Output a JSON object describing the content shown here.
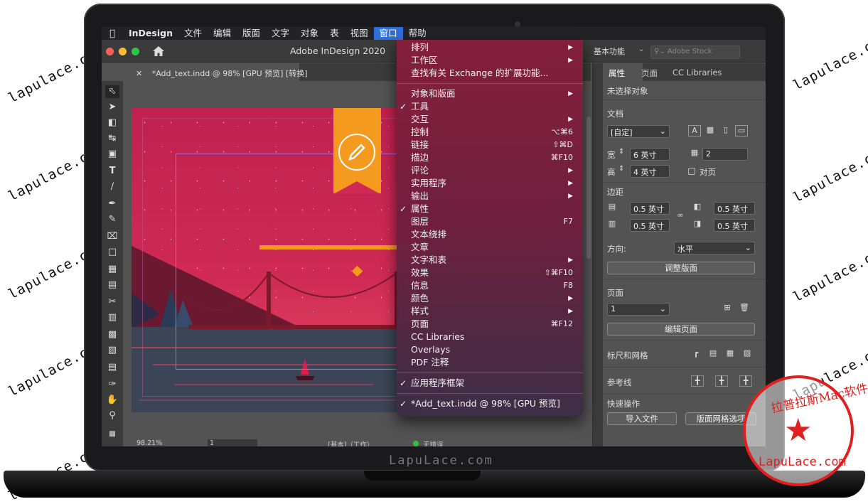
{
  "watermarks": [
    "lapulace.com",
    "lapulace.com",
    "lapulace.com",
    "lapulace.com",
    "lapulace.com",
    "lapulace.com",
    "lapulace.com",
    "lapulace.com",
    "lapulace.com",
    "lapulace.com"
  ],
  "laptop_brand": "LapuLace.com",
  "menubar": {
    "app": "InDesign",
    "items": [
      "文件",
      "编辑",
      "版面",
      "文字",
      "对象",
      "表",
      "视图",
      "窗口",
      "帮助"
    ]
  },
  "titlebar": {
    "title": "Adobe InDesign 2020",
    "workspace": "基本功能",
    "stock_placeholder": "Adobe Stock"
  },
  "doc_tab": {
    "name": "*Add_text.indd @ 98% [GPU 预览] [转换]"
  },
  "window_menu": {
    "items": [
      {
        "label": "排列",
        "shortcut": "",
        "submenu": true,
        "checked": false
      },
      {
        "label": "工作区",
        "shortcut": "",
        "submenu": true,
        "checked": false
      },
      {
        "label": "查找有关 Exchange 的扩展功能...",
        "shortcut": "",
        "submenu": false,
        "checked": false
      },
      {
        "sep": true
      },
      {
        "label": "对象和版面",
        "shortcut": "",
        "submenu": true,
        "checked": false
      },
      {
        "label": "工具",
        "shortcut": "",
        "submenu": false,
        "checked": true
      },
      {
        "label": "交互",
        "shortcut": "",
        "submenu": true,
        "checked": false
      },
      {
        "label": "控制",
        "shortcut": "⌥⌘6",
        "submenu": false,
        "checked": false
      },
      {
        "label": "链接",
        "shortcut": "⇧⌘D",
        "submenu": false,
        "checked": false
      },
      {
        "label": "描边",
        "shortcut": "⌘F10",
        "submenu": false,
        "checked": false
      },
      {
        "label": "评论",
        "shortcut": "",
        "submenu": true,
        "checked": false
      },
      {
        "label": "实用程序",
        "shortcut": "",
        "submenu": true,
        "checked": false
      },
      {
        "label": "输出",
        "shortcut": "",
        "submenu": true,
        "checked": false
      },
      {
        "label": "属性",
        "shortcut": "",
        "submenu": false,
        "checked": true
      },
      {
        "label": "图层",
        "shortcut": "F7",
        "submenu": false,
        "checked": false
      },
      {
        "label": "文本绕排",
        "shortcut": "",
        "submenu": false,
        "checked": false
      },
      {
        "label": "文章",
        "shortcut": "",
        "submenu": false,
        "checked": false
      },
      {
        "label": "文字和表",
        "shortcut": "",
        "submenu": true,
        "checked": false
      },
      {
        "label": "效果",
        "shortcut": "⇧⌘F10",
        "submenu": false,
        "checked": false
      },
      {
        "label": "信息",
        "shortcut": "F8",
        "submenu": false,
        "checked": false
      },
      {
        "label": "颜色",
        "shortcut": "",
        "submenu": true,
        "checked": false
      },
      {
        "label": "样式",
        "shortcut": "",
        "submenu": true,
        "checked": false
      },
      {
        "label": "页面",
        "shortcut": "⌘F12",
        "submenu": false,
        "checked": false
      },
      {
        "label": "CC Libraries",
        "shortcut": "",
        "submenu": false,
        "checked": false
      },
      {
        "label": "Overlays",
        "shortcut": "",
        "submenu": false,
        "checked": false
      },
      {
        "label": "PDF 注释",
        "shortcut": "",
        "submenu": false,
        "checked": false
      },
      {
        "sep": true
      },
      {
        "label": "应用程序框架",
        "shortcut": "",
        "submenu": false,
        "checked": true
      },
      {
        "sep": true
      },
      {
        "label": "*Add_text.indd @ 98% [GPU 预览]",
        "shortcut": "",
        "submenu": false,
        "checked": true
      }
    ]
  },
  "panel": {
    "tabs": [
      "属性",
      "页面",
      "CC Libraries"
    ],
    "no_selection": "未选择对象",
    "document_heading": "文档",
    "preset": "[自定]",
    "width_label": "宽",
    "width_value": "6 英寸",
    "height_label": "高",
    "height_value": "4 英寸",
    "pages_value": "2",
    "facing_pages": "对页",
    "margins_heading": "边距",
    "margin_top": "0.5 英寸",
    "margin_bottom": "0.5 英寸",
    "margin_left": "0.5 英寸",
    "margin_right": "0.5 英寸",
    "orientation_label": "方向:",
    "orientation_value": "水平",
    "adjust_layout": "调整版面",
    "page_heading": "页面",
    "page_value": "1",
    "edit_page": "编辑页面",
    "rulers_grids": "标尺和网格",
    "guides": "参考线",
    "quick_actions": "快速操作",
    "import_file": "导入文件",
    "layout_grid_options": "版面网格选项"
  },
  "statusbar": {
    "zoom": "98.21%",
    "page": "1",
    "style": "[基本]（工作）",
    "errors": "无错误"
  },
  "seal": {
    "top_text": "拉普拉斯Mac软件",
    "bottom_text": "LapuLace.com"
  },
  "colors": {
    "accent": "#2f6fd8",
    "ribbon": "#f39a1f",
    "sky": "#c0214f"
  }
}
